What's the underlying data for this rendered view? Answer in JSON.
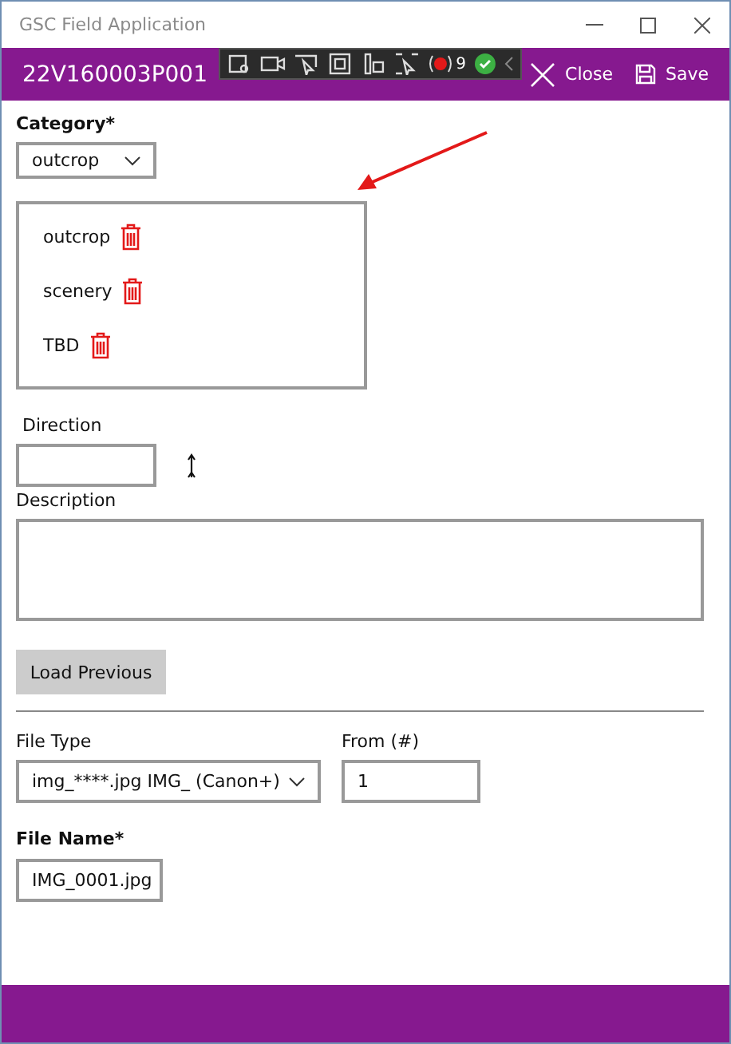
{
  "window": {
    "title": "GSC Field Application"
  },
  "header": {
    "title": "22V160003P001",
    "actions": [
      {
        "label": "Close",
        "kind": "close"
      },
      {
        "label": "Save",
        "kind": "save"
      }
    ]
  },
  "debug_toolbar": {
    "counter": "9"
  },
  "category": {
    "label": "Category*",
    "value": "outcrop",
    "items": [
      {
        "label": "outcrop"
      },
      {
        "label": "scenery"
      },
      {
        "label": "TBD"
      }
    ]
  },
  "direction": {
    "label": "Direction"
  },
  "description": {
    "label": "Description"
  },
  "load_button": {
    "label": "Load Previous"
  },
  "file_type": {
    "label": "File Type",
    "value": "img_****.jpg IMG_ (Canon+)"
  },
  "from": {
    "label": "From (#)",
    "value": "1"
  },
  "file_name": {
    "label": "File Name*",
    "value": "IMG_0001.jpg"
  }
}
